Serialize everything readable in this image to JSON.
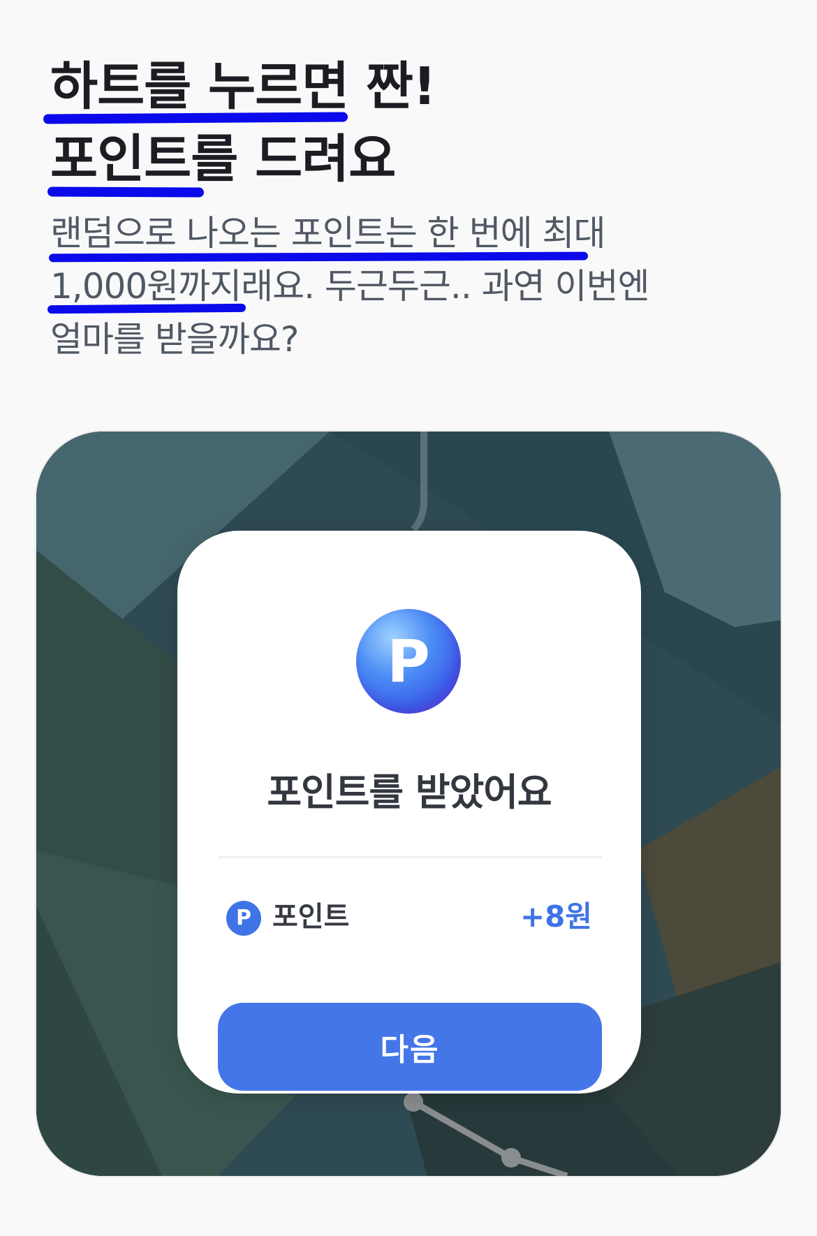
{
  "headline": {
    "line1": "하트를 누르면 짠!",
    "line2": "포인트를 드려요"
  },
  "subtext": {
    "line1": "랜덤으로 나오는 포인트는 한 번에 최대",
    "line2": "1,000원까지래요. 두근두근.. 과연 이번엔",
    "line3": "얼마를 받을까요?"
  },
  "colors": {
    "underline": "#0a0aeb",
    "accent": "#4476e8",
    "background": "#f9f9fa"
  },
  "modal": {
    "coin_letter": "P",
    "title": "포인트를 받았어요",
    "row": {
      "icon_letter": "P",
      "label": "포인트",
      "value": "+8원"
    },
    "next_button_label": "다음"
  },
  "icons": {
    "coin": "point-coin-icon",
    "row": "point-badge-icon"
  }
}
